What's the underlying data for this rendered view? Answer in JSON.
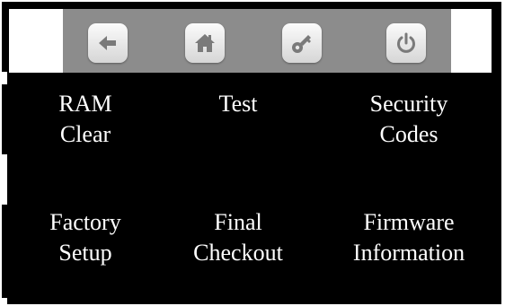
{
  "toolbar": {
    "buttons": [
      {
        "icon": "back-arrow-icon"
      },
      {
        "icon": "home-icon"
      },
      {
        "icon": "key-icon"
      },
      {
        "icon": "power-icon"
      }
    ],
    "icon_color": "#7a7a7a"
  },
  "menu": {
    "ram_clear": {
      "line1": "RAM",
      "line2": "Clear"
    },
    "test": {
      "line1": "Test"
    },
    "security_codes": {
      "line1": "Security",
      "line2": "Codes"
    },
    "factory_setup": {
      "line1": "Factory",
      "line2": "Setup"
    },
    "final_checkout": {
      "line1": "Final",
      "line2": "Checkout"
    },
    "firmware_information": {
      "line1": "Firmware",
      "line2": "Information"
    }
  }
}
